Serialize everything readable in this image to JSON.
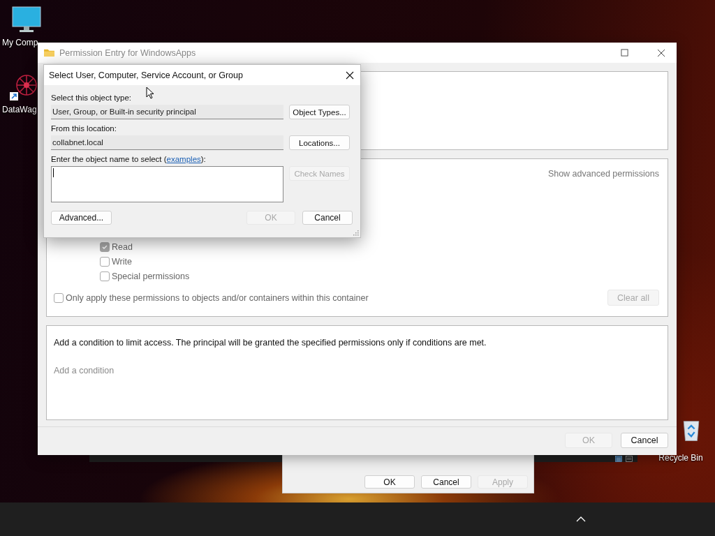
{
  "desktop": {
    "icons": [
      {
        "kind": "computer",
        "label": "My Comp"
      },
      {
        "kind": "app",
        "label": "DataWag"
      },
      {
        "kind": "bin",
        "label": "Recycle Bin"
      }
    ]
  },
  "properties_dialog": {
    "buttons": [
      {
        "label": "OK",
        "disabled": false
      },
      {
        "label": "Cancel",
        "disabled": false
      },
      {
        "label": "Apply",
        "disabled": true
      }
    ]
  },
  "permission_entry": {
    "title": "Permission Entry for WindowsApps",
    "show_advanced": "Show advanced permissions",
    "permissions": [
      {
        "label": "Read",
        "checked": true
      },
      {
        "label": "Write",
        "checked": false
      },
      {
        "label": "Special permissions",
        "checked": false
      }
    ],
    "only_apply": {
      "label": "Only apply these permissions to objects and/or containers within this container",
      "checked": false
    },
    "clear_all": {
      "label": "Clear all",
      "disabled": true
    },
    "condition_text": "Add a condition to limit access. The principal will be granted the specified permissions only if conditions are met.",
    "add_condition": "Add a condition",
    "buttons": [
      {
        "label": "OK",
        "disabled": true
      },
      {
        "label": "Cancel",
        "disabled": false
      }
    ]
  },
  "select_dialog": {
    "title": "Select User, Computer, Service Account, or Group",
    "object_type_label": "Select this object type:",
    "object_type_value": "User, Group, or Built-in security principal",
    "object_types_button": {
      "label": "Object Types...",
      "disabled": false
    },
    "location_label": "From this location:",
    "location_value": "collabnet.local",
    "locations_button": {
      "label": "Locations...",
      "disabled": false
    },
    "name_label_parts": [
      "Enter the object name to select (",
      "examples",
      "):"
    ],
    "check_names_button": {
      "label": "Check Names",
      "disabled": true
    },
    "buttons": [
      {
        "kind": "advanced",
        "label": "Advanced...",
        "disabled": false
      },
      {
        "kind": "ok",
        "label": "OK",
        "disabled": true
      },
      {
        "kind": "cancel",
        "label": "Cancel",
        "disabled": false
      }
    ]
  }
}
